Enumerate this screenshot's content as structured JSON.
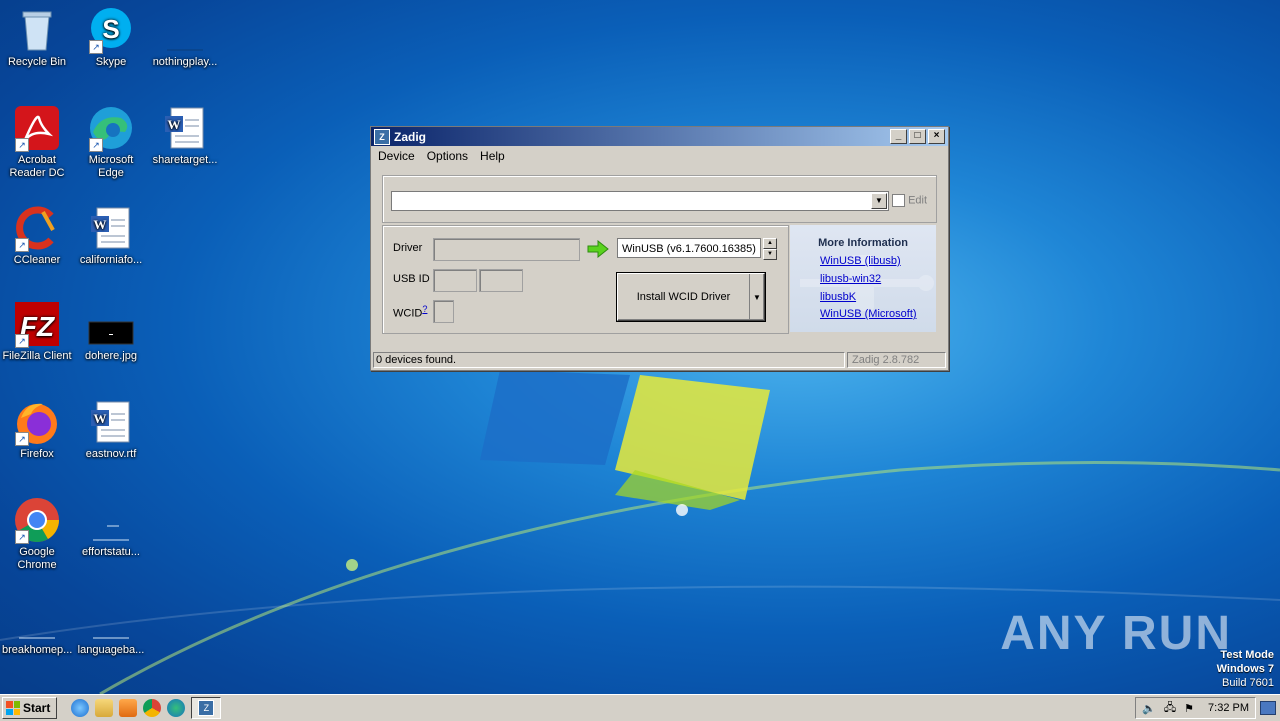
{
  "desktop": {
    "icons": [
      {
        "label": "Recycle Bin",
        "icon": "recycle-bin-icon"
      },
      {
        "label": "Skype",
        "icon": "skype-icon"
      },
      {
        "label": "nothingplay...",
        "icon": "blank-file-icon"
      },
      {
        "label": "Acrobat Reader DC",
        "icon": "acrobat-icon"
      },
      {
        "label": "Microsoft Edge",
        "icon": "edge-icon"
      },
      {
        "label": "sharetarget...",
        "icon": "word-doc-icon"
      },
      {
        "label": "CCleaner",
        "icon": "ccleaner-icon"
      },
      {
        "label": "californiafo...",
        "icon": "word-doc-icon"
      },
      {
        "label": "FileZilla Client",
        "icon": "filezilla-icon"
      },
      {
        "label": "dohere.jpg",
        "icon": "image-file-icon"
      },
      {
        "label": "Firefox",
        "icon": "firefox-icon"
      },
      {
        "label": "eastnov.rtf",
        "icon": "word-doc-icon"
      },
      {
        "label": "Google Chrome",
        "icon": "chrome-icon"
      },
      {
        "label": "effortstatu...",
        "icon": "blank-file-icon"
      },
      {
        "label": "breakhomep...",
        "icon": "blank-file-icon"
      },
      {
        "label": "languageba...",
        "icon": "blank-file-icon"
      }
    ]
  },
  "window": {
    "title": "Zadig",
    "menu": [
      "Device",
      "Options",
      "Help"
    ],
    "edit_label": "Edit",
    "driver_label": "Driver",
    "usb_id_label": "USB ID",
    "wcid_label": "WCID",
    "wcid_help": "?",
    "target_driver": "WinUSB (v6.1.7600.16385)",
    "install_button": "Install WCID Driver",
    "more_info": {
      "title": "More Information",
      "links": [
        "WinUSB (libusb)",
        "libusb-win32",
        "libusbK",
        "WinUSB (Microsoft)"
      ]
    },
    "status": "0 devices found.",
    "version": "Zadig 2.8.782"
  },
  "taskbar": {
    "start_label": "Start",
    "clock": "7:32 PM"
  },
  "watermark": "ANY RUN",
  "test_mode": {
    "line1": "Test Mode",
    "line2": "Windows 7",
    "line3": "Build 7601"
  }
}
